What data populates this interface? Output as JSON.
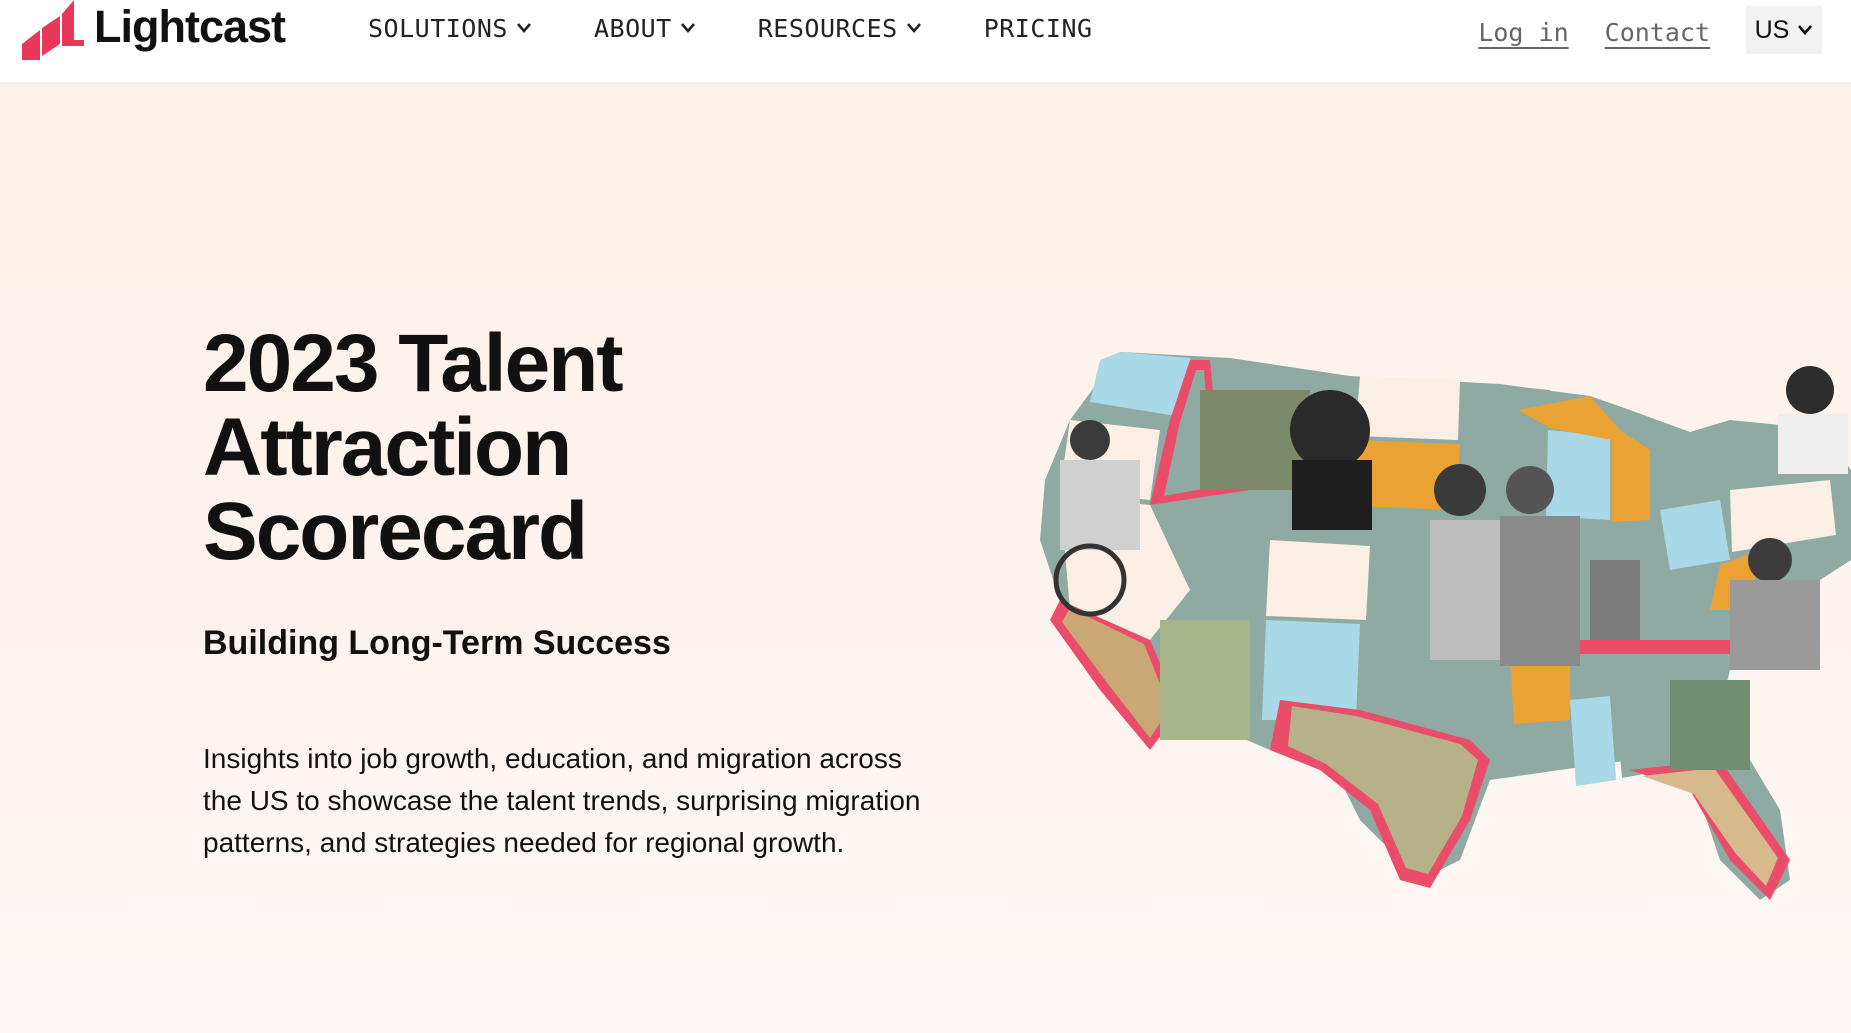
{
  "header": {
    "brand": "Lightcast",
    "nav": [
      {
        "label": "SOLUTIONS"
      },
      {
        "label": "ABOUT"
      },
      {
        "label": "RESOURCES"
      },
      {
        "label": "PRICING"
      }
    ],
    "login_label": "Log in",
    "contact_label": "Contact",
    "locale_label": "US"
  },
  "hero": {
    "title_lines": [
      "2023 Talent",
      "Attraction",
      "Scorecard"
    ],
    "subtitle": "Building Long-Term Success",
    "description": "Insights into job growth, education, and migration across the US to showcase the talent trends, surprising migration patterns, and strategies needed for regional growth."
  },
  "colors": {
    "brand_red": "#e8385a",
    "map_teal": "#8fa9a3",
    "map_blue": "#a9d8e6",
    "map_orange": "#eaa232",
    "map_cream": "#fbeee4",
    "map_pink": "#ea4d6a"
  }
}
